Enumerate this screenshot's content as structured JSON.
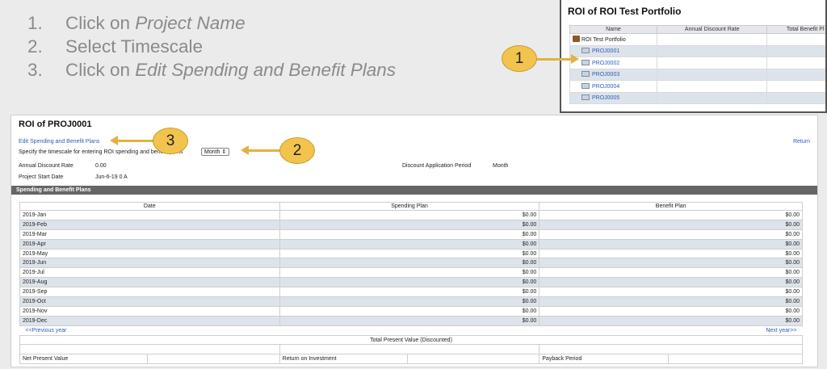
{
  "instructions": [
    {
      "num": "1.",
      "prefix": "Click on ",
      "emph": "Project Name"
    },
    {
      "num": "2.",
      "prefix": "Select Timescale",
      "emph": ""
    },
    {
      "num": "3.",
      "prefix": "Click on ",
      "emph": "Edit Spending and Benefit Plans"
    }
  ],
  "callouts": {
    "c1": "1",
    "c2": "2",
    "c3": "3"
  },
  "portfolio": {
    "title": "ROI of ROI Test Portfolio",
    "headers": [
      "Name",
      "Annual Discount Rate",
      "Total Benefit Pl"
    ],
    "root": "ROI Test Portfolio",
    "projects": [
      "PROJ0001",
      "PROJ0002",
      "PROJ0003",
      "PROJ0004",
      "PROJ0005"
    ]
  },
  "roi": {
    "title": "ROI of PROJ0001",
    "edit_link": "Edit Spending and Benefit Plans",
    "return_link": "Return",
    "timescale_label": "Specify the timescale for entering ROI spending and benefit plans",
    "timescale_value": "Month",
    "annual_discount_label": "Annual Discount Rate",
    "annual_discount_value": "0.00",
    "discount_period_label": "Discount Application Period",
    "discount_period_value": "Month",
    "start_label": "Project Start Date",
    "start_value": "Jun-6-19 0 A",
    "section_title": "Spending and Benefit Plans",
    "columns": [
      "Date",
      "Spending Plan",
      "Benefit Plan"
    ],
    "rows": [
      {
        "date": "2019-Jan",
        "spend": "$0.00",
        "benefit": "$0.00"
      },
      {
        "date": "2019-Feb",
        "spend": "$0.00",
        "benefit": "$0.00"
      },
      {
        "date": "2019-Mar",
        "spend": "$0.00",
        "benefit": "$0.00"
      },
      {
        "date": "2019-Apr",
        "spend": "$0.00",
        "benefit": "$0.00"
      },
      {
        "date": "2019-May",
        "spend": "$0.00",
        "benefit": "$0.00"
      },
      {
        "date": "2019-Jun",
        "spend": "$0.00",
        "benefit": "$0.00"
      },
      {
        "date": "2019-Jul",
        "spend": "$0.00",
        "benefit": "$0.00"
      },
      {
        "date": "2019-Aug",
        "spend": "$0.00",
        "benefit": "$0.00"
      },
      {
        "date": "2019-Sep",
        "spend": "$0.00",
        "benefit": "$0.00"
      },
      {
        "date": "2019-Oct",
        "spend": "$0.00",
        "benefit": "$0.00"
      },
      {
        "date": "2019-Nov",
        "spend": "$0.00",
        "benefit": "$0.00"
      },
      {
        "date": "2019-Dec",
        "spend": "$0.00",
        "benefit": "$0.00"
      }
    ],
    "prev_year": "<<Previous year",
    "next_year": "Next year>>",
    "total_pv_label": "Total Present Value (Discounted)",
    "npv_label": "Net Present Value",
    "roi_label": "Return on Investment",
    "payback_label": "Payback Period"
  }
}
